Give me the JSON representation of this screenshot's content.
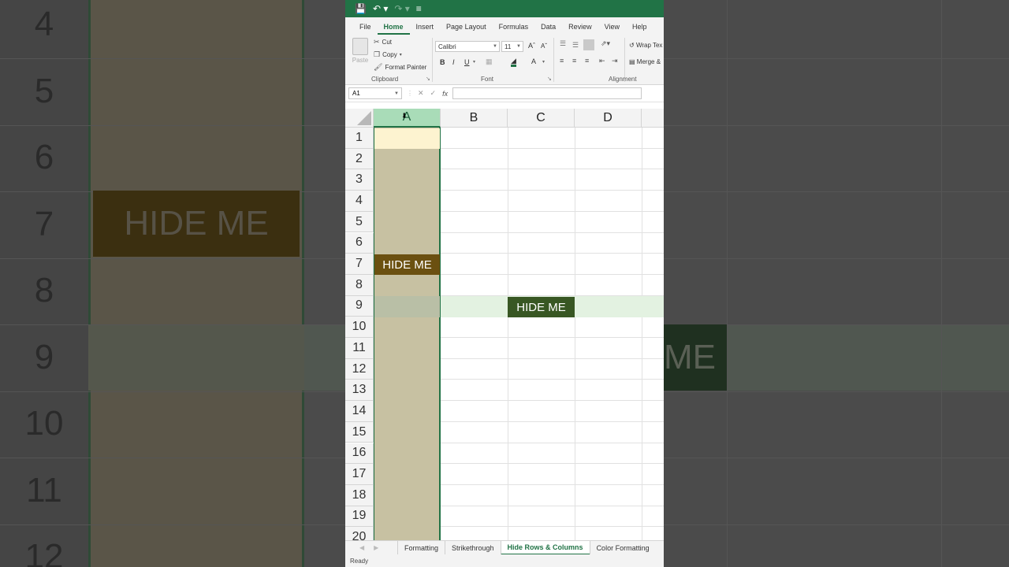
{
  "background": {
    "row_numbers": [
      "4",
      "5",
      "6",
      "7",
      "8",
      "9",
      "10",
      "11",
      "12"
    ],
    "hide_label_left": "HIDE ME",
    "hide_label_right": "ME"
  },
  "title_bar": {
    "save_icon": "save-icon",
    "undo_icon": "undo-icon",
    "redo_icon": "redo-icon",
    "customize_icon": "customize-icon"
  },
  "ribbon_tabs": [
    "File",
    "Home",
    "Insert",
    "Page Layout",
    "Formulas",
    "Data",
    "Review",
    "View",
    "Help"
  ],
  "clipboard": {
    "paste": "Paste",
    "cut": "Cut",
    "copy": "Copy",
    "format_painter": "Format Painter",
    "label": "Clipboard"
  },
  "font": {
    "name": "Calibri",
    "size": "11",
    "bold": "B",
    "italic": "I",
    "underline": "U",
    "label": "Font"
  },
  "alignment": {
    "wrap_text": "Wrap Tex",
    "merge": "Merge &",
    "label": "Alignment"
  },
  "name_box": "A1",
  "formula_bar": {
    "fx": "fx",
    "cancel": "✕",
    "enter": "✓"
  },
  "columns": [
    "A",
    "B",
    "C",
    "D"
  ],
  "rows": [
    "1",
    "2",
    "3",
    "4",
    "5",
    "6",
    "7",
    "8",
    "9",
    "10",
    "11",
    "12",
    "13",
    "14",
    "15",
    "16",
    "17",
    "18",
    "19",
    "20"
  ],
  "cells": {
    "a7": "HIDE ME",
    "c9": "HIDE ME"
  },
  "sheet_tabs": [
    "Formatting",
    "Strikethrough",
    "Hide Rows & Columns",
    "Color Formatting"
  ],
  "active_sheet": "Hide Rows & Columns",
  "status": "Ready",
  "colors": {
    "excel_green": "#217346",
    "column_a_fill": "#c7c1a2",
    "hide_brown": "#6b5010",
    "hide_green": "#385723"
  }
}
